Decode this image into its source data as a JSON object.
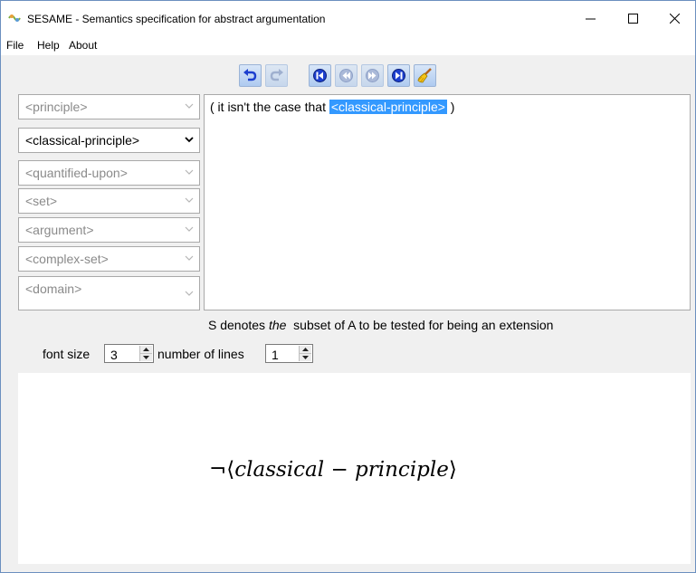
{
  "window": {
    "title": "SESAME - Semantics specification for abstract argumentation",
    "minimize_symbol": "—",
    "maximize_symbol": "☐",
    "close_symbol": "✕"
  },
  "menu": {
    "items": [
      "File",
      "Help",
      "About"
    ]
  },
  "toolbar": {
    "buttons": [
      {
        "name": "undo",
        "icon": "undo-icon",
        "enabled": true
      },
      {
        "name": "redo",
        "icon": "redo-icon",
        "enabled": false
      },
      {
        "name": "first",
        "icon": "first-icon",
        "enabled": true
      },
      {
        "name": "previous",
        "icon": "previous-icon",
        "enabled": false
      },
      {
        "name": "next",
        "icon": "next-icon",
        "enabled": false
      },
      {
        "name": "last",
        "icon": "last-icon",
        "enabled": true
      },
      {
        "name": "clear",
        "icon": "broom-icon",
        "enabled": true
      }
    ]
  },
  "rules": {
    "items": [
      {
        "label": "<principle>",
        "selected": false
      },
      {
        "label": "<classical-principle>",
        "selected": true
      },
      {
        "label": "<quantified-upon>",
        "selected": false
      },
      {
        "label": "<set>",
        "selected": false
      },
      {
        "label": "<argument>",
        "selected": false
      },
      {
        "label": "<complex-set>",
        "selected": false
      },
      {
        "label": "<domain>",
        "selected": false
      }
    ]
  },
  "editor": {
    "prefix": "( it isn't the case that ",
    "highlighted": "<classical-principle>",
    "suffix": " )"
  },
  "description": {
    "before": "S denotes ",
    "emphasis": "the",
    "after": "  subset of A to be tested for being an extension"
  },
  "controls": {
    "font_size_label": "font size",
    "font_size_value": "3",
    "lines_label": "number of lines",
    "lines_value": "1"
  },
  "formula": {
    "neg": "¬",
    "open": "⟨",
    "term1": "classical",
    "minus": " − ",
    "term2": "principle",
    "close": "⟩"
  },
  "colors": {
    "accent": "#3399ff",
    "toolbar_blue": "#1c3fcf"
  }
}
